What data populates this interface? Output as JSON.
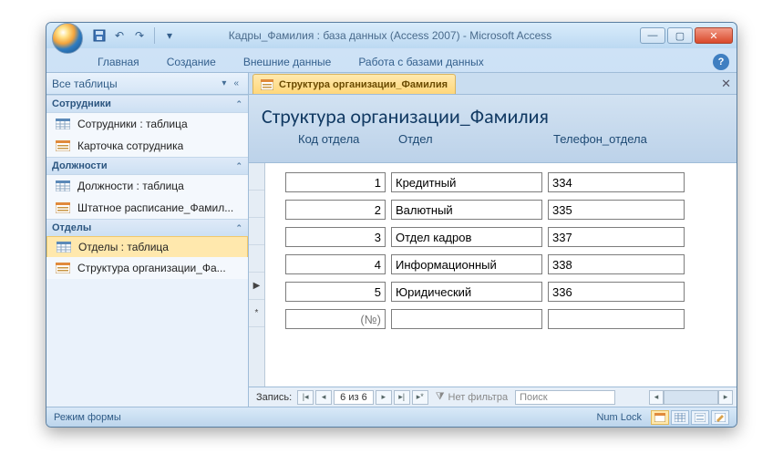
{
  "window": {
    "title": "Кадры_Фамилия : база данных (Access 2007)  -  Microsoft Access"
  },
  "ribbon": {
    "tabs": [
      "Главная",
      "Создание",
      "Внешние данные",
      "Работа с базами данных"
    ]
  },
  "nav": {
    "header": "Все таблицы",
    "groups": [
      {
        "title": "Сотрудники",
        "items": [
          {
            "kind": "table",
            "label": "Сотрудники : таблица"
          },
          {
            "kind": "form",
            "label": "Карточка сотрудника"
          }
        ]
      },
      {
        "title": "Должности",
        "items": [
          {
            "kind": "table",
            "label": "Должности : таблица"
          },
          {
            "kind": "form",
            "label": "Штатное расписание_Фамил..."
          }
        ]
      },
      {
        "title": "Отделы",
        "items": [
          {
            "kind": "table",
            "label": "Отделы : таблица",
            "selected": true
          },
          {
            "kind": "form",
            "label": "Структура организации_Фа..."
          }
        ]
      }
    ]
  },
  "doc": {
    "tab_label": "Структура организации_Фамилия",
    "form_title": "Структура организации_Фамилия",
    "columns": [
      "Код отдела",
      "Отдел",
      "Телефон_отдела"
    ],
    "rows": [
      {
        "code": "1",
        "dept": "Кредитный",
        "phone": "334"
      },
      {
        "code": "2",
        "dept": "Валютный",
        "phone": "335"
      },
      {
        "code": "3",
        "dept": "Отдел кадров",
        "phone": "337"
      },
      {
        "code": "4",
        "dept": "Информационный",
        "phone": "338"
      },
      {
        "code": "5",
        "dept": "Юридический",
        "phone": "336"
      }
    ],
    "new_row_placeholder": "(№)"
  },
  "recnav": {
    "label": "Запись:",
    "counter": "6 из 6",
    "filter_label": "Нет фильтра",
    "search_placeholder": "Поиск"
  },
  "status": {
    "mode": "Режим формы",
    "numlock": "Num Lock"
  }
}
